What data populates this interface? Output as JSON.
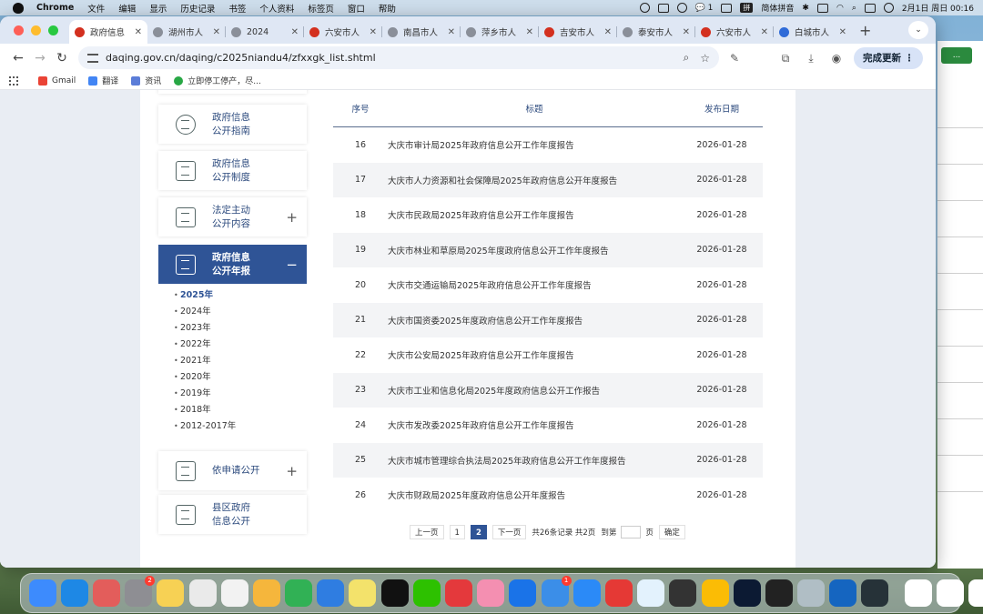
{
  "menubar": {
    "app": "Chrome",
    "items": [
      "文件",
      "编辑",
      "显示",
      "历史记录",
      "书签",
      "个人资料",
      "标签页",
      "窗口",
      "帮助"
    ],
    "wechat_badge": "1",
    "ime": "拼",
    "ime_label": "简体拼音",
    "clock": "2月1日 周日  00:16"
  },
  "tabs": [
    {
      "label": "政府信息",
      "active": true
    },
    {
      "label": "湖州市人"
    },
    {
      "label": "2024"
    },
    {
      "label": "六安市人"
    },
    {
      "label": "南昌市人"
    },
    {
      "label": "萍乡市人"
    },
    {
      "label": "吉安市人"
    },
    {
      "label": "泰安市人"
    },
    {
      "label": "六安市人"
    },
    {
      "label": "白城市人"
    }
  ],
  "toolbar": {
    "url": "daqing.gov.cn/daqing/c2025niandu4/zfxxgk_list.shtml",
    "update_label": "完成更新"
  },
  "bookmarks": [
    {
      "label": "Gmail",
      "color": "#ea4335"
    },
    {
      "label": "翻译",
      "color": "#4285f4"
    },
    {
      "label": "资讯",
      "color": "#5b7dd8"
    },
    {
      "label": "立即停工停产，尽...",
      "color": "#28a745"
    }
  ],
  "sidebar": {
    "cards": [
      {
        "label1": "政府信息",
        "label2": "公开指南",
        "icon": "compass-icon",
        "has_plus": false
      },
      {
        "label1": "政府信息",
        "label2": "公开制度",
        "icon": "document-star-icon",
        "has_plus": false
      },
      {
        "label1": "法定主动",
        "label2": "公开内容",
        "icon": "gavel-icon",
        "has_plus": true
      },
      {
        "label1": "政府信息",
        "label2": "公开年报",
        "icon": "newspaper-icon",
        "has_plus": true,
        "active": true
      },
      {
        "label1": "依申请公开",
        "label2": "",
        "icon": "pen-icon",
        "has_plus": true
      },
      {
        "label1": "县区政府",
        "label2": "信息公开",
        "icon": "link-icon",
        "has_plus": false
      }
    ],
    "plus_symbol": "+",
    "minus_symbol": "−",
    "years": [
      "2025年",
      "2024年",
      "2023年",
      "2022年",
      "2021年",
      "2020年",
      "2019年",
      "2018年",
      "2012-2017年"
    ],
    "current_year": "2025年"
  },
  "table": {
    "headers": {
      "no": "序号",
      "title": "标题",
      "date": "发布日期"
    },
    "rows": [
      {
        "no": "16",
        "title": "大庆市审计局2025年政府信息公开工作年度报告",
        "date": "2026-01-28"
      },
      {
        "no": "17",
        "title": "大庆市人力资源和社会保障局2025年政府信息公开年度报告",
        "date": "2026-01-28"
      },
      {
        "no": "18",
        "title": "大庆市民政局2025年政府信息公开工作年度报告",
        "date": "2026-01-28"
      },
      {
        "no": "19",
        "title": "大庆市林业和草原局2025年度政府信息公开工作年度报告",
        "date": "2026-01-28"
      },
      {
        "no": "20",
        "title": "大庆市交通运输局2025年政府信息公开工作年度报告",
        "date": "2026-01-28"
      },
      {
        "no": "21",
        "title": "大庆市国资委2025年度政府信息公开工作年度报告",
        "date": "2026-01-28"
      },
      {
        "no": "22",
        "title": "大庆市公安局2025年政府信息公开工作年度报告",
        "date": "2026-01-28"
      },
      {
        "no": "23",
        "title": "大庆市工业和信息化局2025年度政府信息公开工作报告",
        "date": "2026-01-28"
      },
      {
        "no": "24",
        "title": "大庆市发改委2025年政府信息公开工作年度报告",
        "date": "2026-01-28"
      },
      {
        "no": "25",
        "title": "大庆市城市管理综合执法局2025年政府信息公开工作年度报告",
        "date": "2026-01-28"
      },
      {
        "no": "26",
        "title": "大庆市财政局2025年度政府信息公开年度报告",
        "date": "2026-01-28"
      }
    ]
  },
  "pager": {
    "prev": "上一页",
    "page1": "1",
    "page2": "2",
    "next": "下一页",
    "summary": "共26条记录 共2页",
    "goto_prefix": "到第",
    "goto_suffix": "页",
    "confirm": "确定"
  },
  "dock": {
    "apps": [
      {
        "name": "finder",
        "color": "#3d8bfd"
      },
      {
        "name": "safari",
        "color": "#1e88e5"
      },
      {
        "name": "launchpad",
        "color": "#e35d5b"
      },
      {
        "name": "settings",
        "color": "#8e8e93",
        "badge": "2"
      },
      {
        "name": "notes",
        "color": "#f7d154"
      },
      {
        "name": "freeform",
        "color": "#eaeaea"
      },
      {
        "name": "textedit",
        "color": "#f2f2f2"
      },
      {
        "name": "pages",
        "color": "#f5b63c"
      },
      {
        "name": "numbers",
        "color": "#31b155"
      },
      {
        "name": "keynote",
        "color": "#2f7de1"
      },
      {
        "name": "stickies",
        "color": "#f3e26b"
      },
      {
        "name": "qq",
        "color": "#111111"
      },
      {
        "name": "wechat",
        "color": "#2dc100"
      },
      {
        "name": "netease-music",
        "color": "#e4393c"
      },
      {
        "name": "bilibili",
        "color": "#f48fb1"
      },
      {
        "name": "tencent-meeting",
        "color": "#1a73e8"
      },
      {
        "name": "qq-browser",
        "color": "#3b8ee8",
        "badge": "1"
      },
      {
        "name": "mail",
        "color": "#2b8af7"
      },
      {
        "name": "wps",
        "color": "#e53935"
      },
      {
        "name": "baidu-netdisk",
        "color": "#e3f2fd"
      },
      {
        "name": "calculator",
        "color": "#333333"
      },
      {
        "name": "chrome",
        "color": "#fbbc05"
      },
      {
        "name": "photoshop",
        "color": "#0c1a33"
      },
      {
        "name": "iphone-mirroring",
        "color": "#222222"
      },
      {
        "name": "preview",
        "color": "#b0bec5"
      },
      {
        "name": "xcode",
        "color": "#1565c0"
      },
      {
        "name": "quicktime",
        "color": "#263238"
      },
      {
        "name": "doc-thumb-1",
        "color": "#ffffff"
      },
      {
        "name": "doc-thumb-2",
        "color": "#ffffff"
      },
      {
        "name": "doc-thumb-3",
        "color": "#ffffff"
      },
      {
        "name": "trash",
        "color": "#cfd8dc"
      }
    ]
  }
}
